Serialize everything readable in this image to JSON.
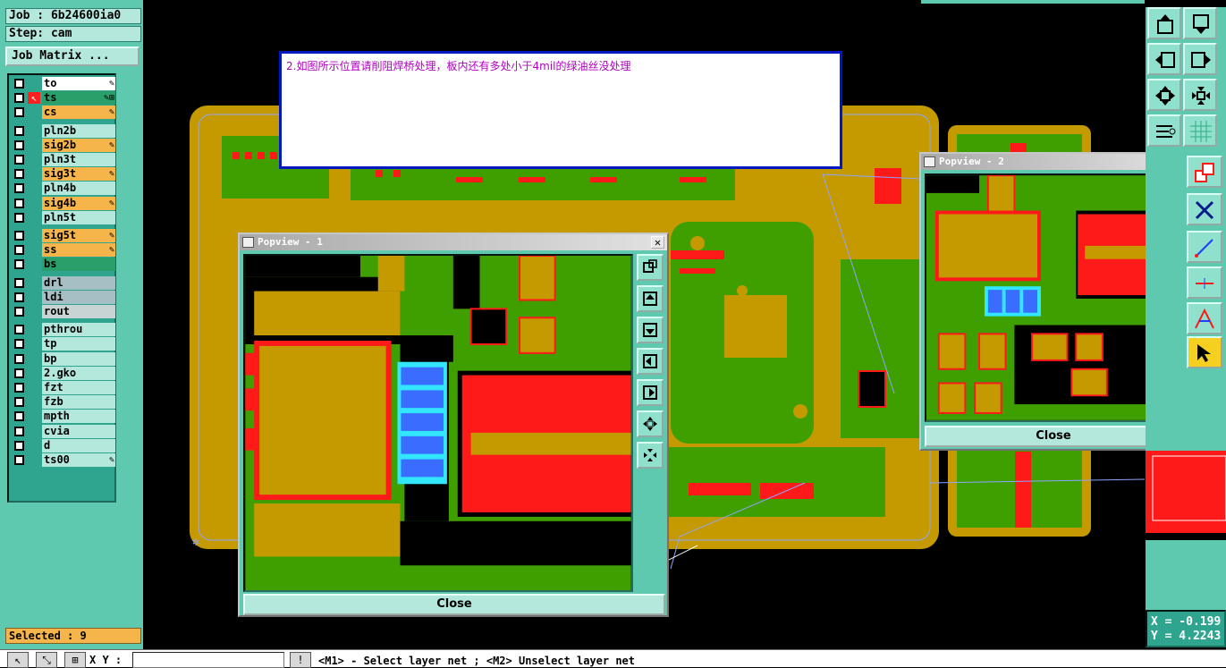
{
  "job_label": "Job : 6b24600ia0",
  "step_label": "Step: cam",
  "job_matrix_button": "Job Matrix ...",
  "layers": [
    {
      "name": "to",
      "color": "#ffffff",
      "flag": "✎"
    },
    {
      "name": "ts",
      "color": "#2a9f6a",
      "flag": "✎⊞",
      "active": true
    },
    {
      "name": "cs",
      "color": "#f5b54a",
      "flag": "✎"
    },
    {
      "name": "pln2b",
      "color": "#b5e8dc",
      "flag": ""
    },
    {
      "name": "sig2b",
      "color": "#f5b54a",
      "flag": "✎"
    },
    {
      "name": "pln3t",
      "color": "#b5e8dc",
      "flag": ""
    },
    {
      "name": "sig3t",
      "color": "#f5b54a",
      "flag": "✎"
    },
    {
      "name": "pln4b",
      "color": "#b5e8dc",
      "flag": ""
    },
    {
      "name": "sig4b",
      "color": "#f5b54a",
      "flag": "✎"
    },
    {
      "name": "pln5t",
      "color": "#b5e8dc",
      "flag": ""
    },
    {
      "name": "sig5t",
      "color": "#f5b54a",
      "flag": "✎"
    },
    {
      "name": "ss",
      "color": "#f5b54a",
      "flag": "✎"
    },
    {
      "name": "bs",
      "color": "#2a9f6a",
      "flag": ""
    },
    {
      "name": "drl",
      "color": "#a6bfc4",
      "flag": ""
    },
    {
      "name": "ldi",
      "color": "#a6bfc4",
      "flag": ""
    },
    {
      "name": "rout",
      "color": "#c8d4d4",
      "flag": ""
    },
    {
      "name": "pthrou",
      "color": "#b5e8dc",
      "flag": ""
    },
    {
      "name": "tp",
      "color": "#b5e8dc",
      "flag": ""
    },
    {
      "name": "bp",
      "color": "#b5e8dc",
      "flag": ""
    },
    {
      "name": "2.gko",
      "color": "#b5e8dc",
      "flag": ""
    },
    {
      "name": "fzt",
      "color": "#b5e8dc",
      "flag": ""
    },
    {
      "name": "fzb",
      "color": "#b5e8dc",
      "flag": ""
    },
    {
      "name": "mpth",
      "color": "#b5e8dc",
      "flag": ""
    },
    {
      "name": "cvia",
      "color": "#b5e8dc",
      "flag": ""
    },
    {
      "name": "d",
      "color": "#b5e8dc",
      "flag": ""
    },
    {
      "name": "ts00",
      "color": "#b5e8dc",
      "flag": "✎"
    }
  ],
  "selected_label": "Selected : 9",
  "xy_label": "X Y :",
  "prompt": "<M1> - Select layer net ; <M2> Unselect layer net",
  "note_text": "2.如图所示位置请削阻焊桥处理，板内还有多处小于4mil的绿油丝没处理",
  "popview1": {
    "title": "Popview - 1",
    "close_label": "Close"
  },
  "popview2": {
    "title": "Popview - 2",
    "close_label": "Close"
  },
  "coords": {
    "x": "X = -0.199",
    "y": "Y = 4.2243"
  },
  "colors": {
    "panel": "#5fc9b0",
    "board_gold": "#c49a00",
    "green": "#3f9f00",
    "red": "#ff1a1a",
    "blue": "#3a6cff",
    "cyan": "#33e6ff"
  }
}
